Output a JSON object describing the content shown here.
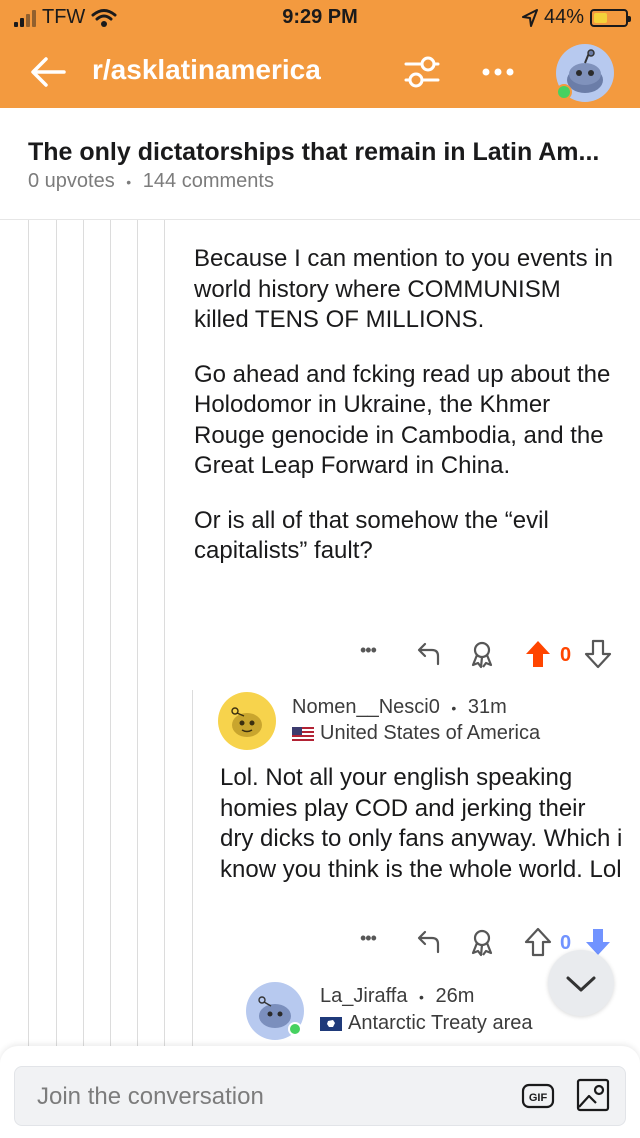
{
  "status_bar": {
    "carrier": "TFW",
    "time": "9:29 PM",
    "battery": "44%",
    "battery_level": 0.44
  },
  "nav": {
    "subreddit": "r/asklatinamerica",
    "icons": [
      "back-arrow-icon",
      "filter-icon",
      "more-icon",
      "avatar"
    ]
  },
  "post": {
    "title": "The only dictatorships that remain in Latin Am...",
    "upvotes": "0 upvotes",
    "separator": "•",
    "comments": "144 comments"
  },
  "comments": [
    {
      "paragraphs": [
        "Because I can mention to you events in world history where COMMUNISM killed TENS OF MILLIONS.",
        "Go ahead and fcking read up about the Holodomor in Ukraine, the Khmer Rouge genocide in Cambodia, and the Great Leap Forward in China.",
        "Or is all of that somehow the “evil capitalists” fault?"
      ],
      "actions": {
        "more": "•••",
        "vote_count": "0",
        "upvoted": true
      }
    },
    {
      "username": "Nomen__Nesci0",
      "age": "31m",
      "separator": "•",
      "flair": "United States of America",
      "paragraphs": [
        "Lol. Not all your english speaking homies play COD and jerking their dry dicks to only fans anyway. Which i know you think is the whole world. Lol"
      ],
      "actions": {
        "more": "•••",
        "vote_count": "0",
        "downvoted": true
      }
    },
    {
      "username": "La_Jiraffa",
      "age": "26m",
      "separator": "•",
      "flair": "Antarctic Treaty area"
    }
  ],
  "reply_bar": {
    "placeholder": "Join the conversation",
    "gif_label": "GIF"
  },
  "colors": {
    "header": "#f39a3f",
    "upvote": "#ff4500",
    "downvote": "#7193ff",
    "online": "#46d160"
  }
}
